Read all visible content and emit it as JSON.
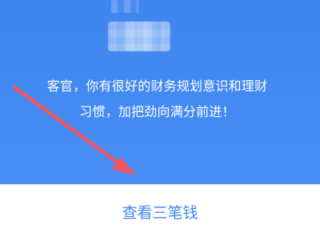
{
  "message": {
    "line1": "客官，你有很好的财务规划意识和理财",
    "line2": "习惯，加把劲向满分前进！"
  },
  "action": {
    "label": "查看三笔钱"
  },
  "colors": {
    "panel_blue": "#4a8ff3",
    "button_text_blue": "#3f86ef",
    "bottom_bar": "#ffffff",
    "arrow_red": "#f3555f"
  },
  "icons": {
    "pointer": "red-arrow-icon"
  }
}
